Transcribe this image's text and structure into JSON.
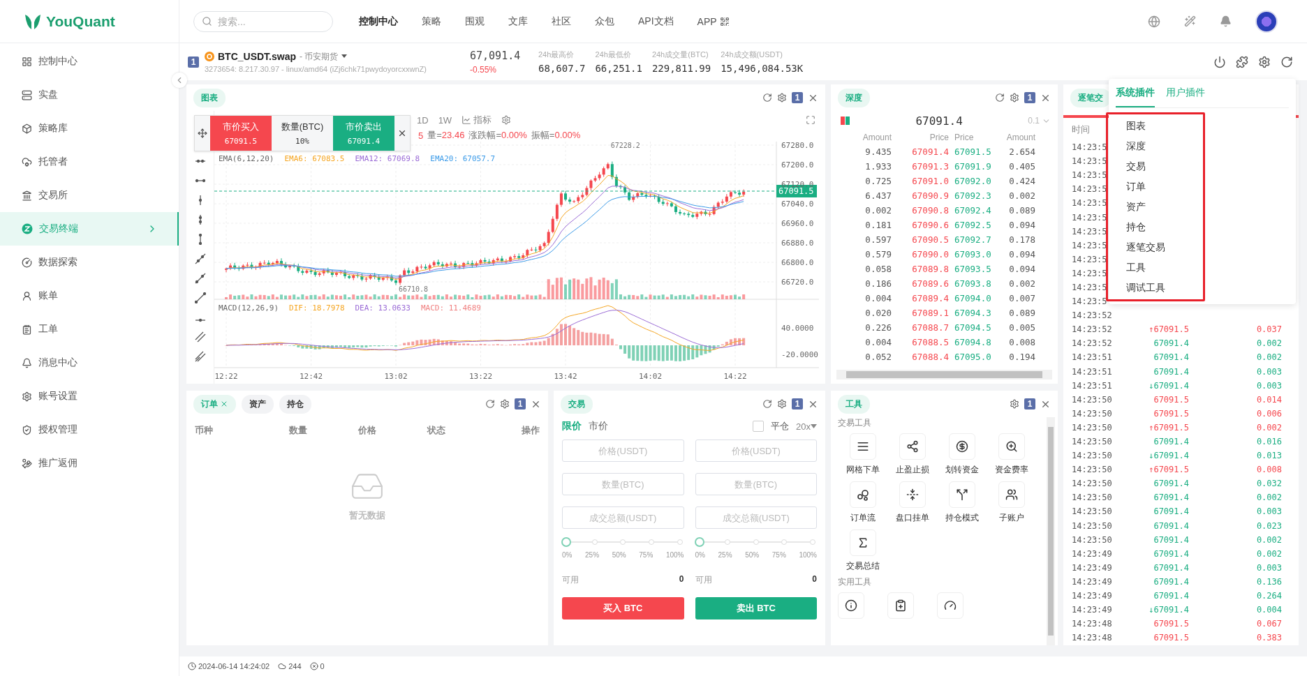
{
  "header": {
    "logo": "YouQuant",
    "search": {
      "placeholder": "搜索..."
    },
    "nav": [
      {
        "label": "控制中心",
        "selected": true,
        "kind": "link"
      },
      {
        "label": "策略",
        "selected": false,
        "kind": "link"
      },
      {
        "label": "围观",
        "selected": false,
        "kind": "link"
      },
      {
        "label": "文库",
        "selected": false,
        "kind": "link"
      },
      {
        "label": "社区",
        "selected": false,
        "kind": "link"
      },
      {
        "label": "众包",
        "selected": false,
        "kind": "link"
      },
      {
        "label": "API文档",
        "selected": false,
        "kind": "link"
      },
      {
        "label": "APP",
        "selected": false,
        "kind": "app"
      }
    ]
  },
  "sidebar": {
    "items": [
      {
        "label": "控制中心",
        "selected": false
      },
      {
        "label": "实盘",
        "selected": false
      },
      {
        "label": "策略库",
        "selected": false
      },
      {
        "label": "托管者",
        "selected": false
      },
      {
        "label": "交易所",
        "selected": false
      },
      {
        "label": "交易终端",
        "selected": true
      },
      {
        "label": "数据探索",
        "selected": false
      },
      {
        "label": "账单",
        "selected": false
      },
      {
        "label": "工单",
        "selected": false
      },
      {
        "label": "消息中心",
        "selected": false
      },
      {
        "label": "账号设置",
        "selected": false
      },
      {
        "label": "授权管理",
        "selected": false
      },
      {
        "label": "推广返佣",
        "selected": false
      }
    ]
  },
  "ticker": {
    "badge": "1",
    "symbol": "BTC_USDT.swap",
    "exchange": "- 币安期货",
    "robot": "3273654: 8.217.30.97 - linux/amd64 (iZj6chk71pwydoyorcxxwnZ)",
    "price": "67,091.4",
    "change": "-0.55%",
    "stats": [
      {
        "label": "24h最高价",
        "value": "68,607.7"
      },
      {
        "label": "24h最低价",
        "value": "66,251.1"
      },
      {
        "label": "24h成交量(BTC)",
        "value": "229,811.99"
      },
      {
        "label": "24h成交额(USDT)",
        "value": "15,496,084.53K"
      }
    ]
  },
  "chart_panel": {
    "tab": "图表",
    "badge": "1",
    "refresh": true,
    "quick_trade": {
      "buy_label": "市价买入",
      "buy_price": "67091.5",
      "qty_label": "数量(BTC)",
      "qty_value": "10%",
      "sell_label": "市价卖出",
      "sell_price": "67091.4"
    },
    "intervals": [
      "1D",
      "1W"
    ],
    "indicator": "指标",
    "info": [
      {
        "value": "5"
      },
      {
        "label": "量=",
        "value": "23.46"
      },
      {
        "label": "涨跌幅=",
        "value": "0.00%"
      },
      {
        "label": "振幅=",
        "value": "0.00%"
      }
    ],
    "ema_legend": [
      {
        "text": "EMA(6,12,20)",
        "color": "#666666"
      },
      {
        "text": "EMA6: 67083.5",
        "color": "#f5a623"
      },
      {
        "text": "EMA12: 67069.8",
        "color": "#9b6cd6"
      },
      {
        "text": "EMA20: 67057.7",
        "color": "#3c9be8"
      }
    ],
    "macd_legend": [
      {
        "text": "MACD(12,26,9)",
        "color": "#666666"
      },
      {
        "text": "DIF: 18.7978",
        "color": "#f5a623"
      },
      {
        "text": "DEA: 13.0633",
        "color": "#9b6cd6"
      },
      {
        "text": "MACD: 11.4689",
        "color": "#f08080"
      }
    ],
    "price_ticks": [
      "67280.0",
      "67200.0",
      "67120.0",
      "67040.0",
      "66960.0",
      "66880.0",
      "66800.0",
      "66720.0"
    ],
    "macd_ticks": [
      "40.0000",
      "-20.0000"
    ],
    "time_ticks": [
      "12:22",
      "12:42",
      "13:02",
      "13:22",
      "13:42",
      "14:02",
      "14:22"
    ],
    "last_price": "67091.5",
    "high_mark": "67228.2",
    "low_mark": "66710.8"
  },
  "depth_panel": {
    "tab": "深度",
    "badge": "1",
    "refresh": true,
    "mid_price": "67091.4",
    "step": "0.1",
    "columns": [
      "Amount",
      "Price",
      "Price",
      "Amount"
    ],
    "rows": [
      {
        "bid_amount": "9.435",
        "bid_price": "67091.4",
        "ask_price": "67091.5",
        "ask_amount": "2.654"
      },
      {
        "bid_amount": "1.933",
        "bid_price": "67091.3",
        "ask_price": "67091.9",
        "ask_amount": "0.405"
      },
      {
        "bid_amount": "0.725",
        "bid_price": "67091.0",
        "ask_price": "67092.0",
        "ask_amount": "0.424"
      },
      {
        "bid_amount": "6.437",
        "bid_price": "67090.9",
        "ask_price": "67092.3",
        "ask_amount": "0.002"
      },
      {
        "bid_amount": "0.002",
        "bid_price": "67090.8",
        "ask_price": "67092.4",
        "ask_amount": "0.089"
      },
      {
        "bid_amount": "0.181",
        "bid_price": "67090.6",
        "ask_price": "67092.5",
        "ask_amount": "0.094"
      },
      {
        "bid_amount": "0.597",
        "bid_price": "67090.5",
        "ask_price": "67092.7",
        "ask_amount": "0.178"
      },
      {
        "bid_amount": "0.579",
        "bid_price": "67090.0",
        "ask_price": "67093.0",
        "ask_amount": "0.094"
      },
      {
        "bid_amount": "0.058",
        "bid_price": "67089.8",
        "ask_price": "67093.5",
        "ask_amount": "0.094"
      },
      {
        "bid_amount": "0.186",
        "bid_price": "67089.6",
        "ask_price": "67093.8",
        "ask_amount": "0.002"
      },
      {
        "bid_amount": "0.004",
        "bid_price": "67089.4",
        "ask_price": "67094.0",
        "ask_amount": "0.007"
      },
      {
        "bid_amount": "0.020",
        "bid_price": "67089.1",
        "ask_price": "67094.3",
        "ask_amount": "0.089"
      },
      {
        "bid_amount": "0.226",
        "bid_price": "67088.7",
        "ask_price": "67094.5",
        "ask_amount": "0.005"
      },
      {
        "bid_amount": "0.004",
        "bid_price": "67088.5",
        "ask_price": "67094.8",
        "ask_amount": "0.008"
      },
      {
        "bid_amount": "0.052",
        "bid_price": "67088.4",
        "ask_price": "67095.0",
        "ask_amount": "0.194"
      }
    ]
  },
  "trades_panel": {
    "tab": "逐笔交",
    "columns": [
      "时间"
    ],
    "rows": [
      {
        "time": "14:23:5"
      },
      {
        "time": "14:23:5"
      },
      {
        "time": "14:23:5"
      },
      {
        "time": "14:23:5"
      },
      {
        "time": "14:23:5"
      },
      {
        "time": "14:23:5"
      },
      {
        "time": "14:23:5"
      },
      {
        "time": "14:23:5"
      },
      {
        "time": "14:23:5"
      },
      {
        "time": "14:23:5"
      },
      {
        "time": "14:23:5"
      },
      {
        "time": "14:23:5"
      },
      {
        "time": "14:23:52"
      },
      {
        "time": "14:23:52",
        "arrow": "↑",
        "price": "67091.5",
        "amount": "0.037",
        "kind": "buy"
      },
      {
        "time": "14:23:52",
        "price": "67091.4",
        "amount": "0.002",
        "kind": "sell"
      },
      {
        "time": "14:23:51",
        "price": "67091.4",
        "amount": "0.002",
        "kind": "sell"
      },
      {
        "time": "14:23:51",
        "price": "67091.4",
        "amount": "0.003",
        "kind": "sell"
      },
      {
        "time": "14:23:51",
        "arrow": "↓",
        "price": "67091.4",
        "amount": "0.003",
        "kind": "sell"
      },
      {
        "time": "14:23:50",
        "price": "67091.5",
        "amount": "0.014",
        "kind": "buy"
      },
      {
        "time": "14:23:50",
        "price": "67091.5",
        "amount": "0.006",
        "kind": "buy"
      },
      {
        "time": "14:23:50",
        "arrow": "↑",
        "price": "67091.5",
        "amount": "0.002",
        "kind": "buy"
      },
      {
        "time": "14:23:50",
        "price": "67091.4",
        "amount": "0.016",
        "kind": "sell"
      },
      {
        "time": "14:23:50",
        "arrow": "↓",
        "price": "67091.4",
        "amount": "0.013",
        "kind": "sell"
      },
      {
        "time": "14:23:50",
        "arrow": "↑",
        "price": "67091.5",
        "amount": "0.008",
        "kind": "buy"
      },
      {
        "time": "14:23:50",
        "price": "67091.4",
        "amount": "0.032",
        "kind": "sell"
      },
      {
        "time": "14:23:50",
        "price": "67091.4",
        "amount": "0.002",
        "kind": "sell"
      },
      {
        "time": "14:23:50",
        "price": "67091.4",
        "amount": "0.003",
        "kind": "sell"
      },
      {
        "time": "14:23:50",
        "price": "67091.4",
        "amount": "0.023",
        "kind": "sell"
      },
      {
        "time": "14:23:50",
        "price": "67091.4",
        "amount": "0.002",
        "kind": "sell"
      },
      {
        "time": "14:23:49",
        "price": "67091.4",
        "amount": "0.002",
        "kind": "sell"
      },
      {
        "time": "14:23:49",
        "price": "67091.4",
        "amount": "0.003",
        "kind": "sell"
      },
      {
        "time": "14:23:49",
        "price": "67091.4",
        "amount": "0.136",
        "kind": "sell"
      },
      {
        "time": "14:23:49",
        "price": "67091.4",
        "amount": "0.264",
        "kind": "sell"
      },
      {
        "time": "14:23:49",
        "arrow": "↓",
        "price": "67091.4",
        "amount": "0.004",
        "kind": "sell"
      },
      {
        "time": "14:23:48",
        "price": "67091.5",
        "amount": "0.067",
        "kind": "buy"
      },
      {
        "time": "14:23:48",
        "price": "67091.5",
        "amount": "0.383",
        "kind": "buy"
      }
    ]
  },
  "orders_panel": {
    "badge": "1",
    "refresh": true,
    "tabs": [
      {
        "label": "订单",
        "selected": true,
        "closable": true
      },
      {
        "label": "资产",
        "selected": false,
        "closable": false
      },
      {
        "label": "持仓",
        "selected": false,
        "closable": false
      }
    ],
    "columns": [
      "币种",
      "数量",
      "价格",
      "状态",
      "操作"
    ],
    "empty": "暂无数据"
  },
  "trade_panel": {
    "tab": "交易",
    "badge": "1",
    "refresh": true,
    "modes": [
      {
        "label": "限价",
        "selected": true
      },
      {
        "label": "市价",
        "selected": false
      }
    ],
    "close_position": {
      "label": "平仓",
      "checked": false
    },
    "leverage": "20x",
    "sides": [
      {
        "kind": "buy",
        "fields": [
          {
            "placeholder": "价格(USDT)"
          },
          {
            "placeholder": "数量(BTC)"
          },
          {
            "placeholder": "成交总额(USDT)"
          }
        ],
        "slider": {
          "level": 0,
          "marks": [
            "0%",
            "25%",
            "50%",
            "75%",
            "100%"
          ]
        },
        "available_label": "可用",
        "available": "0",
        "button": "买入 BTC"
      },
      {
        "kind": "sell",
        "fields": [
          {
            "placeholder": "价格(USDT)"
          },
          {
            "placeholder": "数量(BTC)"
          },
          {
            "placeholder": "成交总额(USDT)"
          }
        ],
        "slider": {
          "level": 0,
          "marks": [
            "0%",
            "25%",
            "50%",
            "75%",
            "100%"
          ]
        },
        "available_label": "可用",
        "available": "0",
        "button": "卖出 BTC"
      }
    ]
  },
  "tools_panel": {
    "tab": "工具",
    "badge": "1",
    "refresh": false,
    "section": "交易工具",
    "items": [
      "网格下单",
      "止盈止损",
      "划转资金",
      "资金费率",
      "订单流",
      "盘口挂单",
      "持仓模式",
      "子账户",
      "交易总结"
    ],
    "utility_section": "实用工具"
  },
  "plugin_menu": {
    "tabs": [
      {
        "label": "系统插件",
        "selected": true
      },
      {
        "label": "用户插件",
        "selected": false
      }
    ],
    "items": [
      "图表",
      "深度",
      "交易",
      "订单",
      "资产",
      "持仓",
      "逐笔交易",
      "工具",
      "调试工具"
    ]
  },
  "status_bar": {
    "time": "2024-06-14 14:24:02",
    "count": "244",
    "errors": "0"
  }
}
